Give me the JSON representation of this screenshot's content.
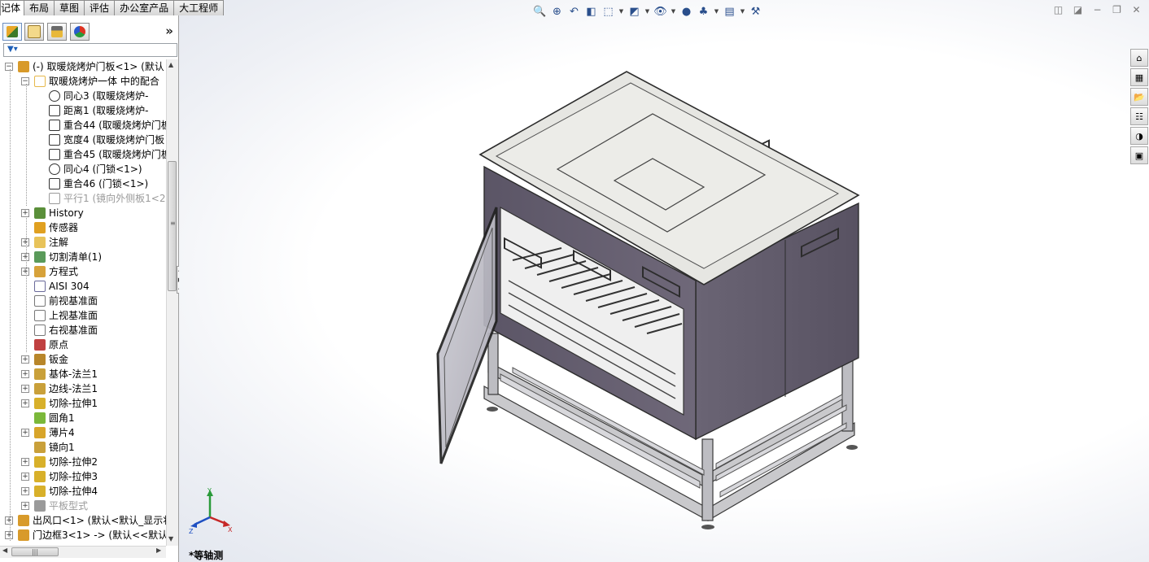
{
  "tabs": [
    {
      "label": "记体",
      "active": true
    },
    {
      "label": "布局",
      "active": false
    },
    {
      "label": "草图",
      "active": false
    },
    {
      "label": "评估",
      "active": false
    },
    {
      "label": "办公室产品",
      "active": false
    },
    {
      "label": "大工程师",
      "active": false
    }
  ],
  "panel": {
    "tab_icons": [
      "feature-manager-icon",
      "property-manager-icon",
      "configuration-manager-icon",
      "display-manager-icon"
    ],
    "expand_glyph": "»",
    "filter_icon": "filter-icon"
  },
  "tree": [
    {
      "label": "(-) 取暖烧烤炉门板<1> (默认",
      "icon": "part-icon",
      "color": "#d89a2a",
      "expander": "-",
      "gray": false
    },
    {
      "label": "取暖烧烤炉一体 中的配合",
      "icon": "mates-folder-icon",
      "color": "#e6b84b",
      "expander": "-",
      "gray": false
    },
    {
      "label": "同心3 (取暖烧烤炉-",
      "icon": "concentric-mate-icon",
      "color": "#333333",
      "expander": "",
      "gray": false
    },
    {
      "label": "距离1 (取暖烧烤炉-",
      "icon": "distance-mate-icon",
      "color": "#333333",
      "expander": "",
      "gray": false
    },
    {
      "label": "重合44 (取暖烧烤炉门板",
      "icon": "coincident-mate-icon",
      "color": "#333333",
      "expander": "",
      "gray": false
    },
    {
      "label": "宽度4 (取暖烧烤炉门板",
      "icon": "width-mate-icon",
      "color": "#333333",
      "expander": "",
      "gray": false
    },
    {
      "label": "重合45 (取暖烧烤炉门板",
      "icon": "coincident-mate-icon",
      "color": "#333333",
      "expander": "",
      "gray": false
    },
    {
      "label": "同心4 (门锁<1>)",
      "icon": "concentric-mate-icon",
      "color": "#333333",
      "expander": "",
      "gray": false
    },
    {
      "label": "重合46 (门锁<1>)",
      "icon": "coincident-mate-icon",
      "color": "#333333",
      "expander": "",
      "gray": false
    },
    {
      "label": "平行1 (镜向外侧板1<2",
      "icon": "parallel-mate-icon",
      "color": "#9a9a9a",
      "expander": "",
      "gray": true
    },
    {
      "label": "History",
      "icon": "history-icon",
      "color": "#5a8f3a",
      "expander": "+",
      "gray": false
    },
    {
      "label": "传感器",
      "icon": "sensor-icon",
      "color": "#e0a020",
      "expander": "",
      "gray": false
    },
    {
      "label": "注解",
      "icon": "annotation-icon",
      "color": "#e8c35a",
      "expander": "+",
      "gray": false
    },
    {
      "label": "切割清单(1)",
      "icon": "cut-list-icon",
      "color": "#5a9a5a",
      "expander": "+",
      "gray": false
    },
    {
      "label": "方程式",
      "icon": "equations-icon",
      "color": "#d7a23a",
      "expander": "+",
      "gray": false
    },
    {
      "label": "AISI 304",
      "icon": "material-icon",
      "color": "#6a6a9a",
      "expander": "",
      "gray": false
    },
    {
      "label": "前视基准面",
      "icon": "plane-icon",
      "color": "#777777",
      "expander": "",
      "gray": false
    },
    {
      "label": "上视基准面",
      "icon": "plane-icon",
      "color": "#777777",
      "expander": "",
      "gray": false
    },
    {
      "label": "右视基准面",
      "icon": "plane-icon",
      "color": "#777777",
      "expander": "",
      "gray": false
    },
    {
      "label": "原点",
      "icon": "origin-icon",
      "color": "#c04040",
      "expander": "",
      "gray": false
    },
    {
      "label": "钣金",
      "icon": "sheet-metal-icon",
      "color": "#b8862a",
      "expander": "+",
      "gray": false
    },
    {
      "label": "基体-法兰1",
      "icon": "base-flange-icon",
      "color": "#c9a03a",
      "expander": "+",
      "gray": false
    },
    {
      "label": "边线-法兰1",
      "icon": "edge-flange-icon",
      "color": "#c9a03a",
      "expander": "+",
      "gray": false
    },
    {
      "label": "切除-拉伸1",
      "icon": "cut-extrude-icon",
      "color": "#d8b02a",
      "expander": "+",
      "gray": false
    },
    {
      "label": "圆角1",
      "icon": "fillet-icon",
      "color": "#7bb83a",
      "expander": "",
      "gray": false
    },
    {
      "label": "薄片4",
      "icon": "tab-icon",
      "color": "#d8a52a",
      "expander": "+",
      "gray": false
    },
    {
      "label": "镜向1",
      "icon": "mirror-icon",
      "color": "#c9a03a",
      "expander": "",
      "gray": false
    },
    {
      "label": "切除-拉伸2",
      "icon": "cut-extrude-icon",
      "color": "#d8b02a",
      "expander": "+",
      "gray": false
    },
    {
      "label": "切除-拉伸3",
      "icon": "cut-extrude-icon",
      "color": "#d8b02a",
      "expander": "+",
      "gray": false
    },
    {
      "label": "切除-拉伸4",
      "icon": "cut-extrude-icon",
      "color": "#d8b02a",
      "expander": "+",
      "gray": false
    },
    {
      "label": "平板型式",
      "icon": "flat-pattern-icon",
      "color": "#9a9a9a",
      "expander": "+",
      "gray": true
    },
    {
      "label": "出风口<1> (默认<默认_显示状",
      "icon": "part-icon",
      "color": "#d89a2a",
      "expander": "+",
      "gray": false
    },
    {
      "label": "门边框3<1> -> (默认<<默认",
      "icon": "part-icon",
      "color": "#d89a2a",
      "expander": "+",
      "gray": false
    }
  ],
  "heads_up_toolbar": [
    {
      "icon": "zoom-to-fit-icon",
      "glyph": "🔍",
      "dropdown": false
    },
    {
      "icon": "zoom-to-area-icon",
      "glyph": "⊕",
      "dropdown": false
    },
    {
      "icon": "previous-view-icon",
      "glyph": "↶",
      "dropdown": false
    },
    {
      "icon": "section-view-icon",
      "glyph": "◧",
      "dropdown": false
    },
    {
      "icon": "view-orientation-icon",
      "glyph": "⬚",
      "dropdown": true
    },
    {
      "icon": "display-style-icon",
      "glyph": "◩",
      "dropdown": true
    },
    {
      "icon": "hide-show-items-icon",
      "glyph": "👁",
      "dropdown": true
    },
    {
      "icon": "edit-appearance-icon",
      "glyph": "●",
      "dropdown": false
    },
    {
      "icon": "apply-scene-icon",
      "glyph": "♣",
      "dropdown": true
    },
    {
      "icon": "view-settings-icon",
      "glyph": "▤",
      "dropdown": true
    },
    {
      "icon": "realview-icon",
      "glyph": "⚒",
      "dropdown": false
    }
  ],
  "window_controls": [
    {
      "icon": "tile-left-icon",
      "glyph": "◫"
    },
    {
      "icon": "tile-right-icon",
      "glyph": "◪"
    },
    {
      "icon": "minimize-icon",
      "glyph": "−"
    },
    {
      "icon": "restore-icon",
      "glyph": "❐"
    },
    {
      "icon": "close-icon",
      "glyph": "✕"
    }
  ],
  "task_pane": [
    {
      "icon": "solidworks-resources-icon",
      "glyph": "⌂"
    },
    {
      "icon": "design-library-icon",
      "glyph": "▦"
    },
    {
      "icon": "file-explorer-icon",
      "glyph": "📂"
    },
    {
      "icon": "view-palette-icon",
      "glyph": "☷"
    },
    {
      "icon": "appearances-icon",
      "glyph": "◑"
    },
    {
      "icon": "custom-properties-icon",
      "glyph": "▣"
    }
  ],
  "triad": {
    "x": "X",
    "y": "Y",
    "z": "Z"
  },
  "view_name": "*等轴测"
}
